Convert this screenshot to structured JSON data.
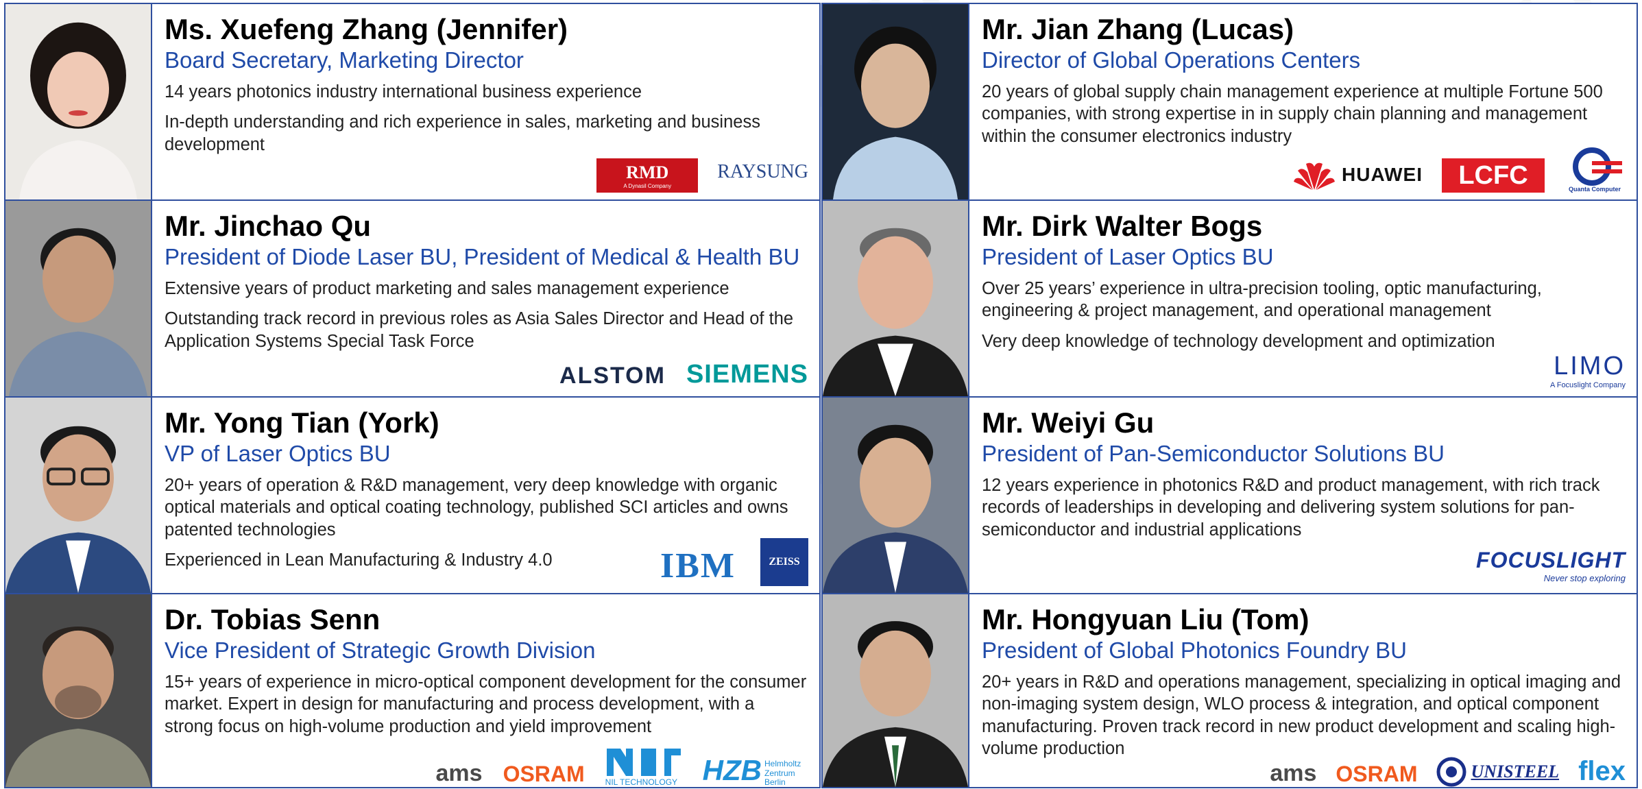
{
  "people": [
    {
      "name": "Ms. Xuefeng Zhang (Jennifer)",
      "title": "Board Secretary, Marketing Director",
      "paras": [
        "14 years photonics industry international business experience",
        "In-depth understanding and rich experience in sales, marketing and business development"
      ],
      "logos": [
        "RMD",
        "RAYSUNG"
      ]
    },
    {
      "name": "Mr. Jian Zhang (Lucas)",
      "title": "Director of Global Operations Centers",
      "paras": [
        "20 years of global supply chain management experience at multiple Fortune 500 companies, with strong expertise in in supply chain planning and management within the consumer electronics industry"
      ],
      "logos": [
        "HUAWEI",
        "LCFC",
        "Quanta Computer"
      ]
    },
    {
      "name": "Mr. Jinchao Qu",
      "title": "President of Diode Laser BU, President of Medical & Health BU",
      "paras": [
        "Extensive years of product marketing and sales management experience",
        "Outstanding track record in previous roles as Asia Sales Director and Head of the Application Systems Special Task Force"
      ],
      "logos": [
        "ALSTOM",
        "SIEMENS"
      ]
    },
    {
      "name": "Mr. Dirk Walter Bogs",
      "title": "President of Laser Optics BU",
      "paras": [
        "Over 25 years’ experience in ultra-precision tooling, optic manufacturing, engineering & project management, and operational management",
        "Very deep knowledge of technology development and optimization"
      ],
      "logos": [
        "LIMO"
      ]
    },
    {
      "name": "Mr. Yong Tian (York)",
      "title": "VP of Laser Optics BU",
      "paras": [
        "20+ years of operation & R&D management, very deep knowledge with organic optical materials and optical coating technology, published SCI articles and owns patented technologies",
        "Experienced in Lean Manufacturing & Industry 4.0"
      ],
      "logos": [
        "IBM",
        "ZEISS"
      ]
    },
    {
      "name": "Mr. Weiyi Gu",
      "title": "President of Pan-Semiconductor Solutions BU",
      "paras": [
        "12 years experience in photonics R&D and product management, with rich track records of leaderships in developing and delivering system solutions for pan-semiconductor and industrial applications"
      ],
      "logos": [
        "FOCUSLIGHT"
      ]
    },
    {
      "name": "Dr. Tobias Senn",
      "title": "Vice President of Strategic Growth Division",
      "paras": [
        "15+ years of experience in micro-optical component development for the consumer market. Expert in design for manufacturing and process development, with a strong focus on high-volume production and yield improvement"
      ],
      "logos": [
        "ams",
        "OSRAM",
        "NIL TECHNOLOGY",
        "HZB"
      ]
    },
    {
      "name": "Mr. Hongyuan Liu (Tom)",
      "title": "President of Global Photonics Foundry BU",
      "paras": [
        "20+ years in R&D and operations management, specializing in optical imaging and non-imaging system design, WLO process & integration, and optical component manufacturing. Proven track record in new product development and scaling high-volume production"
      ],
      "logos": [
        "ams",
        "OSRAM",
        "UNISTEEL",
        "flex"
      ]
    }
  ],
  "logo_text": {
    "rmd": "RMD",
    "rmd_sub": "A Dynasil Company",
    "raysung": "RAYSUNG",
    "huawei": "HUAWEI",
    "lcfc": "LCFC",
    "quanta": "Quanta Computer",
    "alstom": "ALSTOM",
    "siemens": "SIEMENS",
    "limo": "LIMO",
    "limo_sub": "A Focuslight Company",
    "ibm": "IBM",
    "zeiss": "ZEISS",
    "focuslight": "FOCUSLIGHT",
    "focuslight_sub": "Never stop exploring",
    "ams": "ams",
    "osram": "OSRAM",
    "nil": "NIL TECHNOLOGY",
    "hzb": "HZB",
    "hzb_sub": "Helmholtz Zentrum Berlin",
    "unisteel": "UNISTEEL",
    "flex": "flex"
  },
  "watermark": "FOCUSLIGHT",
  "colors": {
    "border": "#2f4f9e",
    "title": "#1f4aa8",
    "rmd": "#c8141c",
    "lcfc": "#e01e26",
    "siemens": "#009999",
    "ibm": "#1f70c1",
    "zeiss": "#1b3c8f",
    "osram": "#f05a1e",
    "focuslight": "#1a3a9a"
  }
}
